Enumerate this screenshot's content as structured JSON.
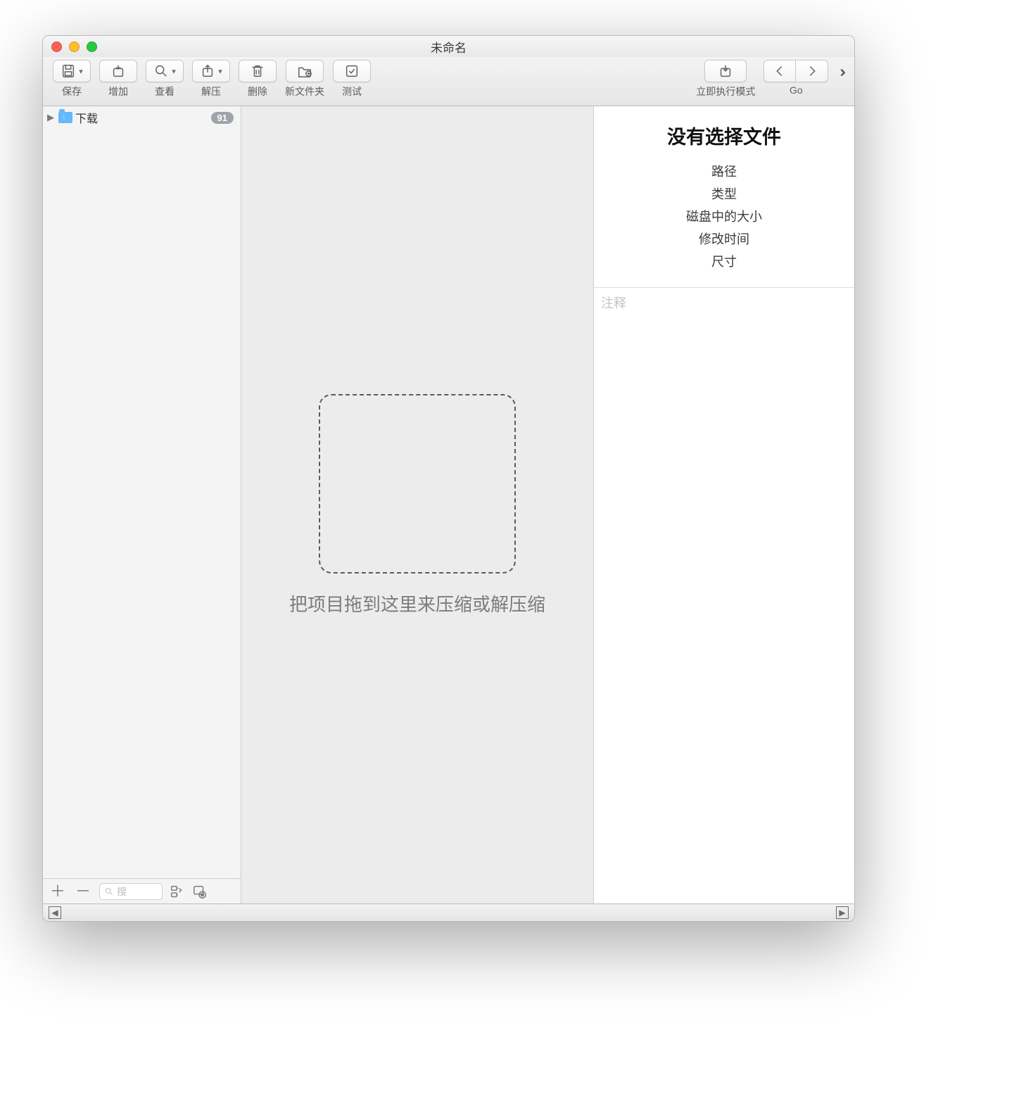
{
  "window": {
    "title": "未命名"
  },
  "toolbar": {
    "save": {
      "label": "保存"
    },
    "add": {
      "label": "增加"
    },
    "view": {
      "label": "查看"
    },
    "extract": {
      "label": "解压"
    },
    "delete": {
      "label": "删除"
    },
    "newfolder": {
      "label": "新文件夹"
    },
    "test": {
      "label": "测试"
    },
    "execute": {
      "label": "立即执行模式"
    },
    "go": {
      "label": "Go"
    }
  },
  "sidebar": {
    "items": [
      {
        "name": "下载",
        "badge": "91"
      }
    ],
    "search_placeholder": "搜"
  },
  "dropzone": {
    "hint": "把项目拖到这里来压缩或解压缩"
  },
  "inspector": {
    "title": "没有选择文件",
    "fields": {
      "path": "路径",
      "type": "类型",
      "disk_size": "磁盘中的大小",
      "modified": "修改时间",
      "dimensions": "尺寸"
    },
    "notes_placeholder": "注释"
  }
}
